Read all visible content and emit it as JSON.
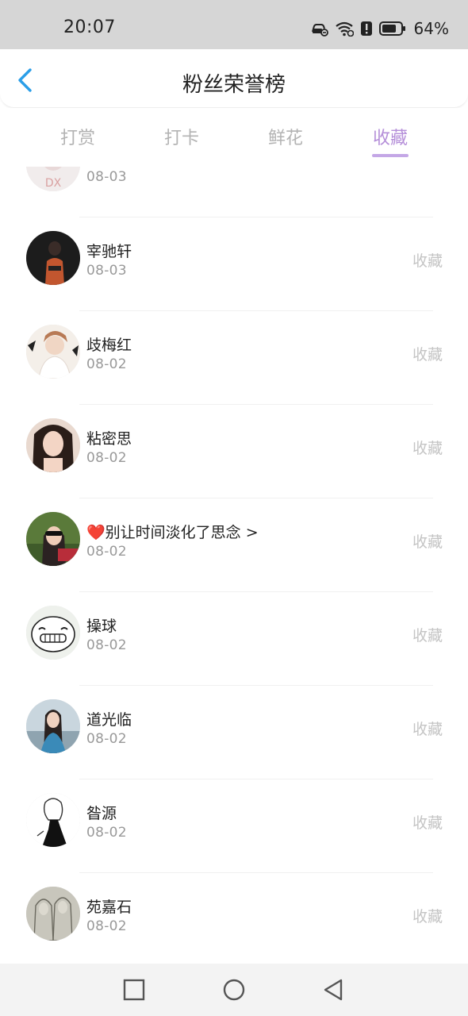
{
  "status_bar": {
    "time": "20:07",
    "battery": "64%"
  },
  "header": {
    "title": "粉丝荣誉榜"
  },
  "tabs": [
    {
      "label": "打赏",
      "active": false
    },
    {
      "label": "打卡",
      "active": false
    },
    {
      "label": "鲜花",
      "active": false
    },
    {
      "label": "收藏",
      "active": true
    }
  ],
  "list": {
    "items": [
      {
        "name": "",
        "date": "08-03",
        "action": ""
      },
      {
        "name": "宰驰轩",
        "date": "08-03",
        "action": "收藏"
      },
      {
        "name": "歧梅红",
        "date": "08-02",
        "action": "收藏"
      },
      {
        "name": "粘密思",
        "date": "08-02",
        "action": "收藏"
      },
      {
        "name": "❤️别让时间淡化了思念 >",
        "date": "08-02",
        "action": "收藏"
      },
      {
        "name": "操球",
        "date": "08-02",
        "action": "收藏"
      },
      {
        "name": "道光临",
        "date": "08-02",
        "action": "收藏"
      },
      {
        "name": "昝源",
        "date": "08-02",
        "action": "收藏"
      },
      {
        "name": "苑嘉石",
        "date": "08-02",
        "action": "收藏"
      }
    ]
  },
  "colors": {
    "accent": "#b58fd9",
    "indicator": "#c4a7e6",
    "back_arrow": "#2a9ee8",
    "status_bar": "#d6d6d6"
  },
  "icons": [
    "back-arrow-icon",
    "car-lock-icon",
    "wifi-icon",
    "alert-icon",
    "battery-icon",
    "recent-apps-icon",
    "home-icon",
    "back-icon"
  ]
}
